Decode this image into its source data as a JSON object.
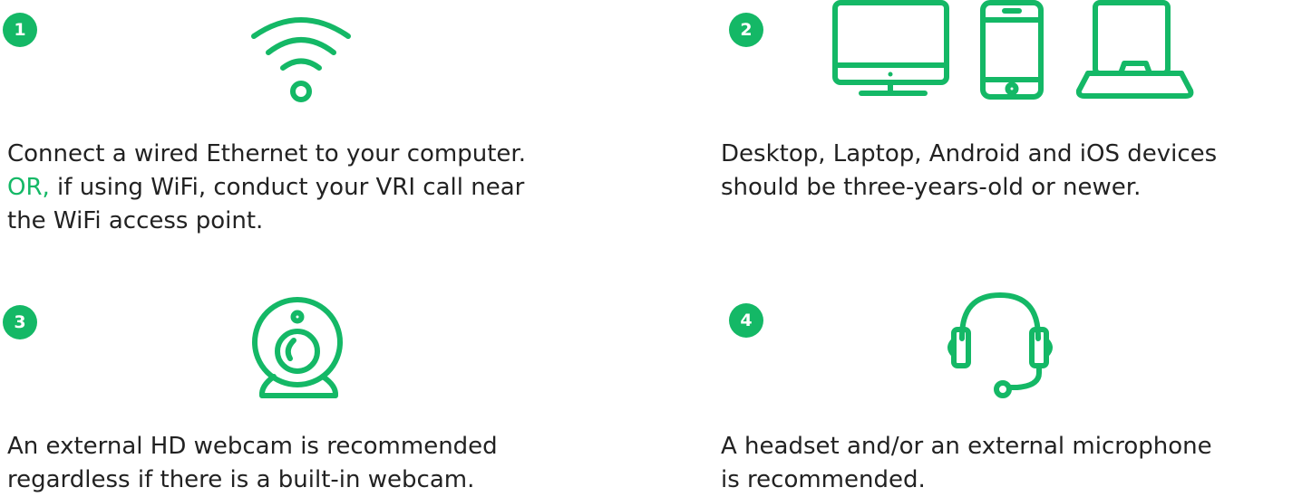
{
  "accent_color": "#14b866",
  "steps": [
    {
      "number": "1",
      "icon": "wifi-icon",
      "line1": "Connect a wired Ethernet to your computer.",
      "or_label": "OR,",
      "line2_rest": " if using WiFi, conduct your VRI call near",
      "line3": "the WiFi access point."
    },
    {
      "number": "2",
      "icon": "devices-icon",
      "line1": "Desktop, Laptop, Android and iOS devices",
      "line2": "should be three-years-old or newer."
    },
    {
      "number": "3",
      "icon": "webcam-icon",
      "line1": "An external HD webcam is recommended",
      "line2": "regardless if there is a built-in webcam."
    },
    {
      "number": "4",
      "icon": "headset-icon",
      "line1": "A headset and/or an external microphone",
      "line2": "is recommended."
    }
  ]
}
